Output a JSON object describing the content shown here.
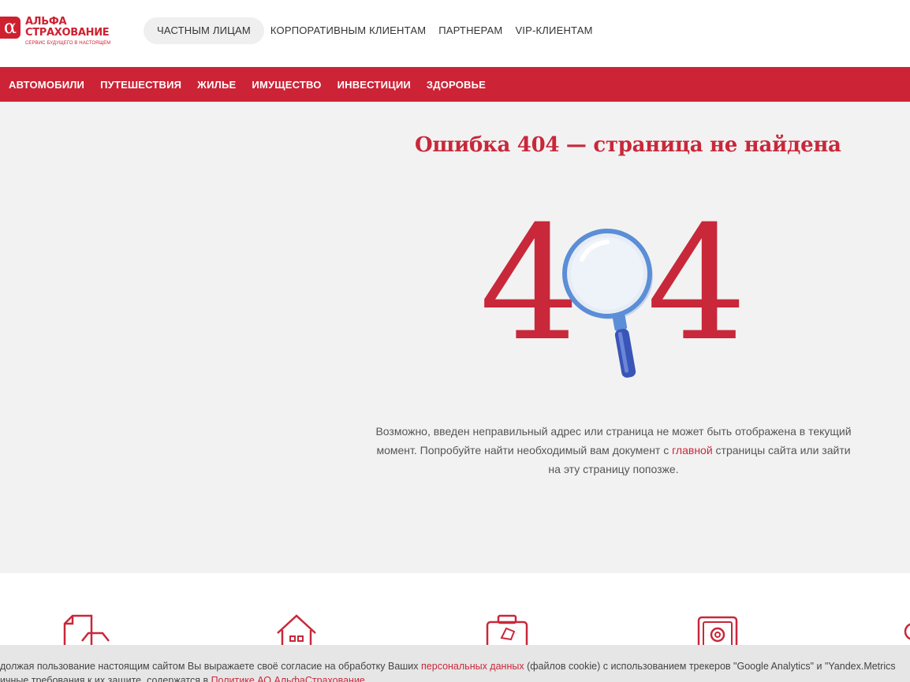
{
  "logo": {
    "mark": "α",
    "line1": "АЛЬФА",
    "line2": "СТРАХОВАНИЕ",
    "tagline": "СЕРВИС БУДУЩЕГО В НАСТОЯЩЕМ"
  },
  "segments": [
    {
      "label": "ЧАСТНЫМ ЛИЦАМ",
      "active": true
    },
    {
      "label": "КОРПОРАТИВНЫМ КЛИЕНТАМ",
      "active": false
    },
    {
      "label": "ПАРТНЕРАМ",
      "active": false
    },
    {
      "label": "VIP-КЛИЕНТАМ",
      "active": false
    }
  ],
  "nav": [
    "АВТОМОБИЛИ",
    "ПУТЕШЕСТВИЯ",
    "ЖИЛЬЕ",
    "ИМУЩЕСТВО",
    "ИНВЕСТИЦИИ",
    "ЗДОРОВЬЕ"
  ],
  "error": {
    "title": "Ошибка 404 — страница не найдена",
    "digit_left": "4",
    "digit_right": "4",
    "text_before": "Возможно, введен неправильный адрес или страница не может быть отображена в текущий момент. Попробуйте найти необходимый вам документ с ",
    "link": "главной",
    "text_after": " страницы сайта или зайти на эту страницу попозже."
  },
  "cookie": {
    "l1_before": "должая пользование настоящим сайтом Вы выражаете своё согласие на обработку Ваших ",
    "l1_link": "персональных данных",
    "l1_after": " (файлов cookie) с использованием трекеров \"Google Analytics\" и \"Yandex.Metrics",
    "l2_before": "ичные требования к их защите, содержатся в ",
    "l2_link": "Политике АО АльфаСтрахование"
  },
  "icons": [
    "document-car-icon",
    "house-icon",
    "suitcase-icon",
    "safe-icon",
    "heart-icon"
  ],
  "colors": {
    "brand_red": "#cc2336",
    "magnifier_blue": "#4a7fd1"
  }
}
